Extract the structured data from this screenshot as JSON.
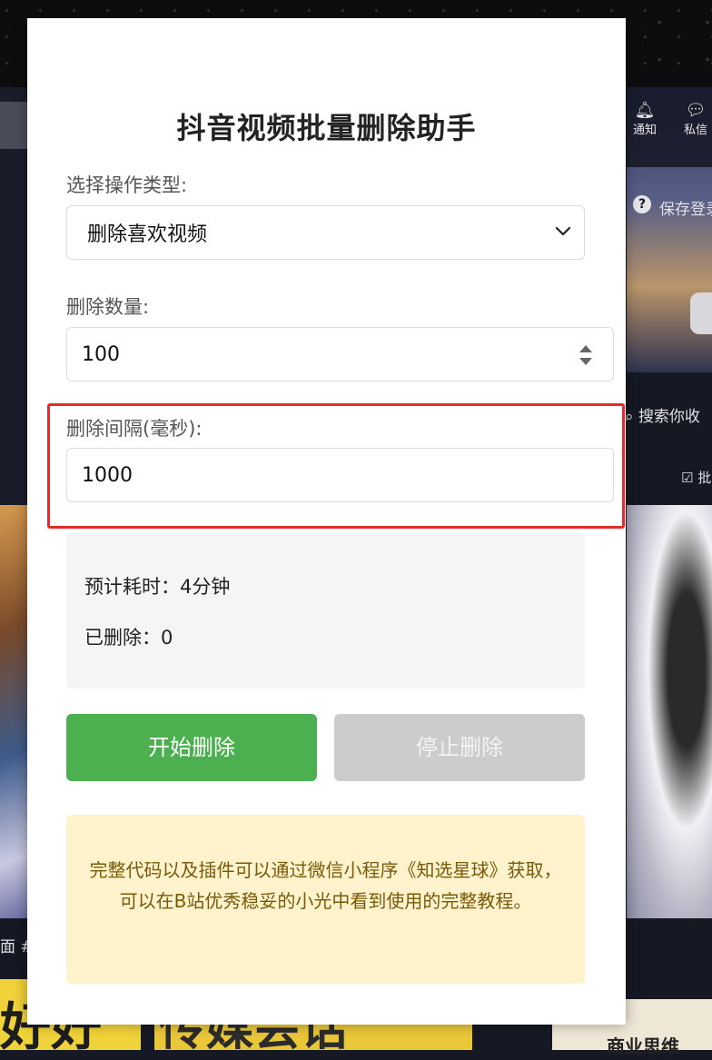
{
  "popup": {
    "title": "抖音视频批量删除助手",
    "operation_label": "选择操作类型:",
    "operation_selected": "删除喜欢视频",
    "count_label": "删除数量:",
    "count_value": "100",
    "interval_label": "删除间隔(毫秒):",
    "interval_value": "1000",
    "estimated_time": "预计耗时：4分钟",
    "deleted_count": "已删除：0",
    "start_button": "开始删除",
    "stop_button": "停止删除",
    "notice_text": "完整代码以及插件可以通过微信小程序《知选星球》获取，可以在B站优秀稳妥的小光中看到使用的完整教程。"
  },
  "background": {
    "nav_notify": "通知",
    "nav_message": "私信",
    "save_login": "保存登录",
    "search_text": "搜索你收",
    "batch_text": "批",
    "hashtag_text": "面 #夏",
    "thumb1_text": "好好",
    "thumb2_text": "传媒会话",
    "thumb3_text": "商业思维"
  },
  "colors": {
    "highlight_border": "#e32b2b",
    "start_button": "#4caf50",
    "stop_button": "#cccccc",
    "notice_bg": "#fff3cd"
  }
}
